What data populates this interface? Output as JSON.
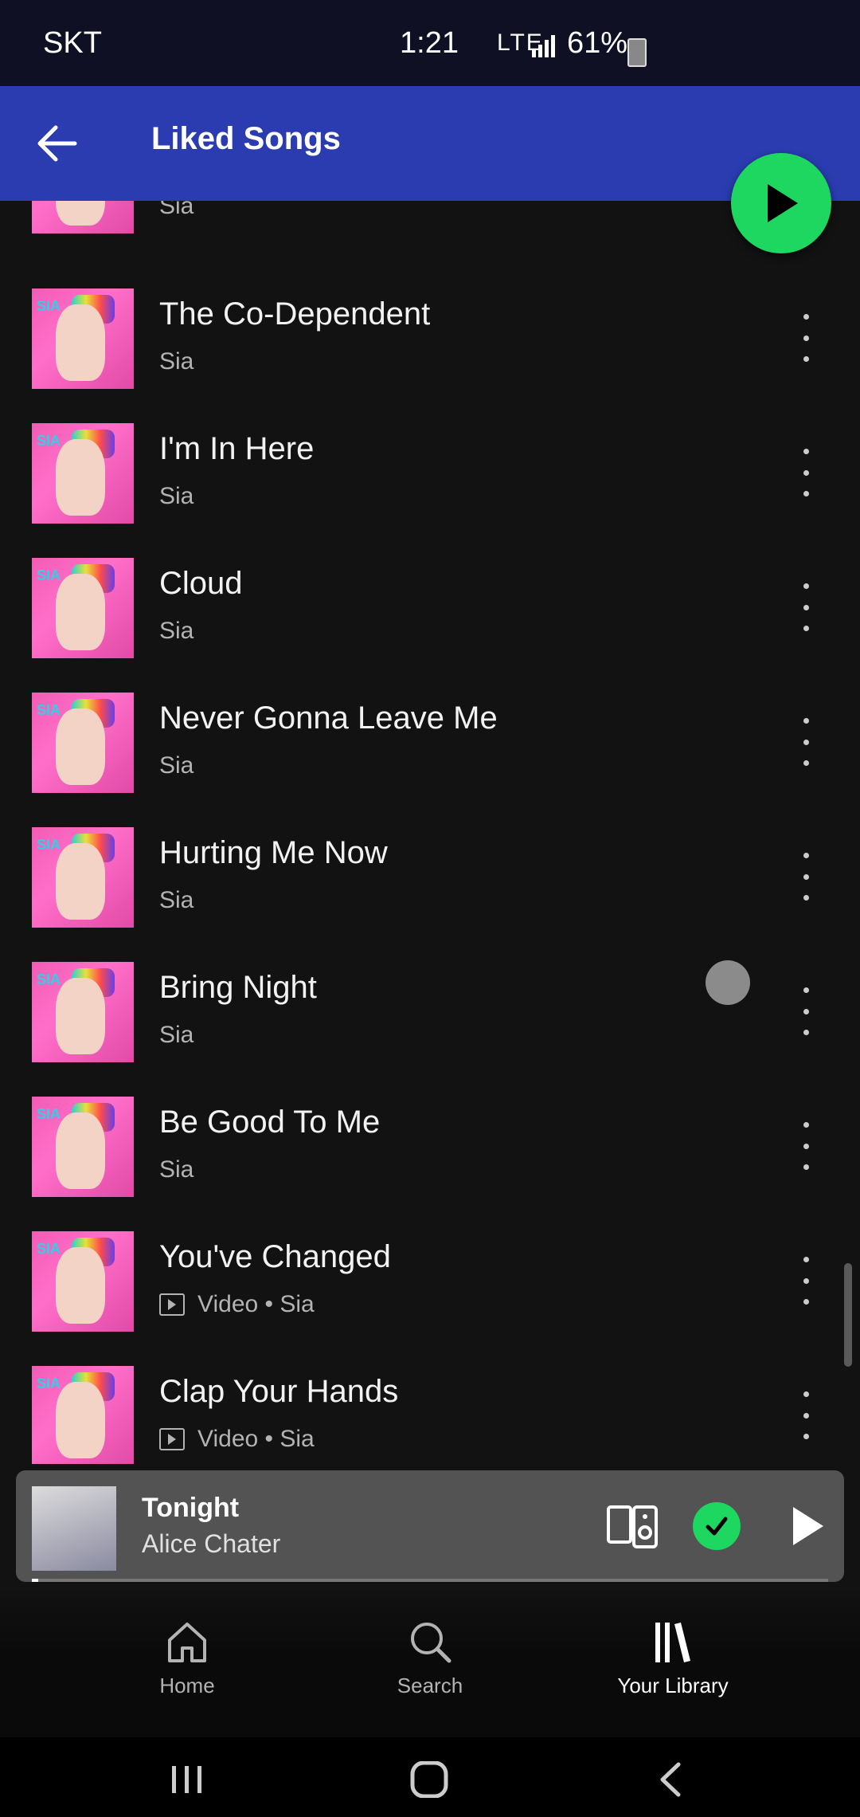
{
  "status_bar": {
    "carrier": "SKT",
    "time": "1:21",
    "network": "LTE",
    "battery": "61%"
  },
  "header": {
    "title": "Liked Songs"
  },
  "songs": [
    {
      "title": "",
      "artist": "Sia",
      "video": false
    },
    {
      "title": "The Co-Dependent",
      "artist": "Sia",
      "video": false
    },
    {
      "title": "I'm In Here",
      "artist": "Sia",
      "video": false
    },
    {
      "title": "Cloud",
      "artist": "Sia",
      "video": false
    },
    {
      "title": "Never Gonna Leave Me",
      "artist": "Sia",
      "video": false
    },
    {
      "title": "Hurting Me Now",
      "artist": "Sia",
      "video": false
    },
    {
      "title": "Bring Night",
      "artist": "Sia",
      "video": false
    },
    {
      "title": "Be Good To Me",
      "artist": "Sia",
      "video": false
    },
    {
      "title": "You've Changed",
      "artist": "Sia",
      "video": true,
      "video_label": "Video •"
    },
    {
      "title": "Clap Your Hands",
      "artist": "Sia",
      "video": true,
      "video_label": "Video •"
    }
  ],
  "now_playing": {
    "title": "Tonight",
    "artist": "Alice Chater",
    "liked": true
  },
  "nav": {
    "home": "Home",
    "search": "Search",
    "library": "Your Library"
  },
  "colors": {
    "accent": "#1ed760",
    "header": "#2a3cb0",
    "background": "#121212"
  }
}
